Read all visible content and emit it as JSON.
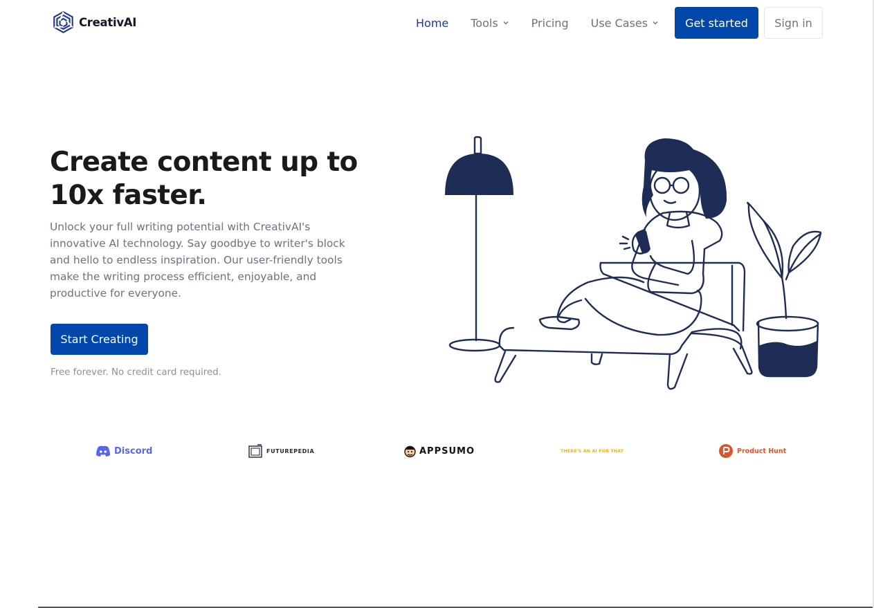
{
  "brand": {
    "name": "CreativAI",
    "accent": "#0047ab",
    "logo_color": "#1e3a8a"
  },
  "nav": {
    "links": [
      {
        "label": "Home",
        "active": true
      },
      {
        "label": "Tools",
        "dropdown": true
      },
      {
        "label": "Pricing"
      },
      {
        "label": "Use Cases",
        "dropdown": true
      }
    ],
    "cta_label": "Get started",
    "signin_label": "Sign in"
  },
  "hero": {
    "title_line1": "Create content up to",
    "title_line2": "10x faster.",
    "description": "Unlock your full writing potential with CreativAI's innovative AI technology. Say goodbye to writer's block and hello to endless inspiration. Our user-friendly tools make the writing process efficient, enjoyable, and productive for everyone.",
    "cta_label": "Start Creating",
    "note": "Free forever. No credit card required."
  },
  "partners": {
    "discord": "Discord",
    "futurepedia": "FUTUREPEDIA",
    "appsumo": "APPSUMO",
    "theresanai": "THERE'S AN AI FOR THAT",
    "producthunt": "Product Hunt"
  }
}
